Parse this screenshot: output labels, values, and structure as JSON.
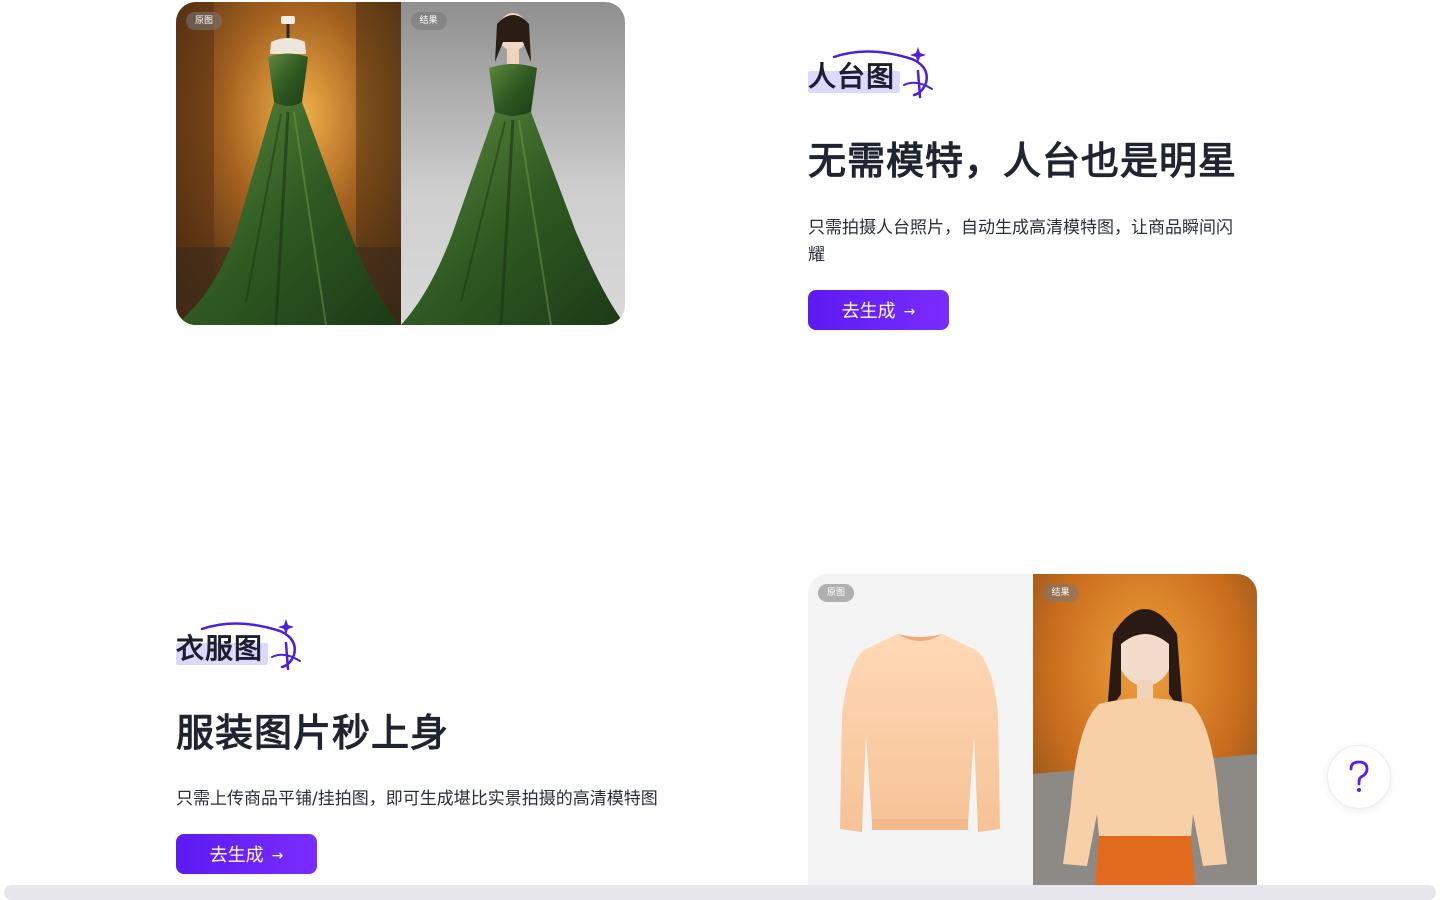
{
  "features": [
    {
      "tag": "人台图",
      "headline": "无需模特，人台也是明星",
      "description": "只需拍摄人台照片，自动生成高清模特图，让商品瞬间闪耀",
      "cta_label": "去生成",
      "before_label": "原图",
      "after_label": "结果"
    },
    {
      "tag": "衣服图",
      "headline": "服装图片秒上身",
      "description": "只需上传商品平铺/挂拍图，即可生成堪比实景拍摄的高清模特图",
      "cta_label": "去生成",
      "before_label": "原图",
      "after_label": "结果"
    }
  ],
  "help_button": {
    "icon": "question-icon"
  },
  "colors": {
    "accent": "#5b1bf2",
    "accent_end": "#7b2cff",
    "tag_highlight": "#dcd8ff",
    "text_dark": "#1f2430"
  }
}
